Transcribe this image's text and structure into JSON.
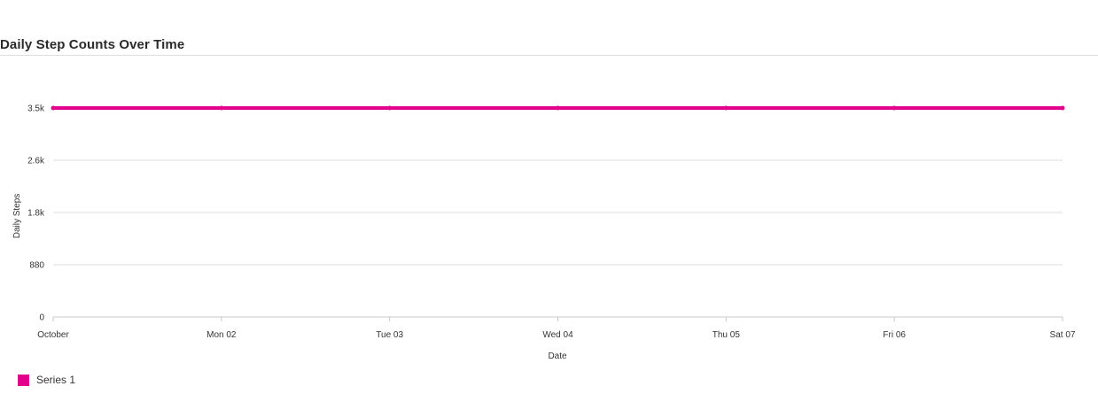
{
  "chart_data": {
    "type": "line",
    "title": "Daily Step Counts Over Time",
    "xlabel": "Date",
    "ylabel": "Daily Steps",
    "x_ticks": [
      "October",
      "Mon 02",
      "Tue 03",
      "Wed 04",
      "Thu 05",
      "Fri 06",
      "Sat 07"
    ],
    "x": [
      "2023-10-01",
      "2023-10-02",
      "2023-10-03",
      "2023-10-04",
      "2023-10-05",
      "2023-10-06",
      "2023-10-07"
    ],
    "y_ticks": [
      "0",
      "880",
      "1.8k",
      "2.6k",
      "3.5k"
    ],
    "ylim": [
      0,
      3500
    ],
    "grid": true,
    "legend_position": "bottom-left",
    "series": [
      {
        "name": "Series 1",
        "color": "#e3008c",
        "values": [
          3500,
          3500,
          3500,
          3500,
          3500,
          3500,
          3500
        ]
      }
    ]
  }
}
